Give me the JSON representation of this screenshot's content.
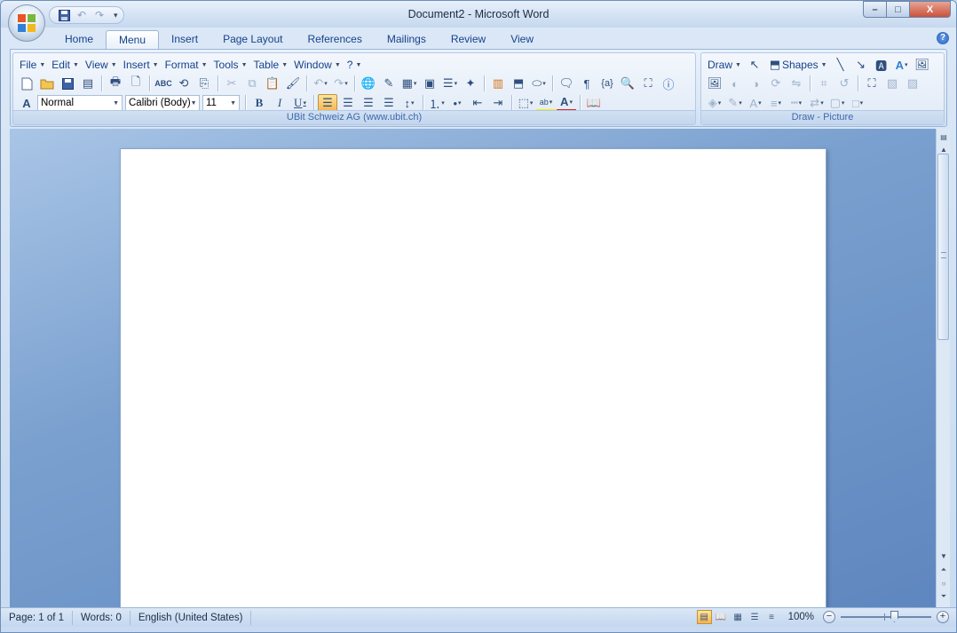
{
  "window": {
    "title": "Document2 - Microsoft Word",
    "controls": {
      "minimize": "–",
      "maximize": "□",
      "close": "X"
    }
  },
  "qat": {
    "items": [
      "save-icon",
      "undo-icon",
      "redo-icon",
      "customize-icon"
    ]
  },
  "tabs": [
    {
      "label": "Home",
      "active": false
    },
    {
      "label": "Menu",
      "active": true
    },
    {
      "label": "Insert",
      "active": false
    },
    {
      "label": "Page Layout",
      "active": false
    },
    {
      "label": "References",
      "active": false
    },
    {
      "label": "Mailings",
      "active": false
    },
    {
      "label": "Review",
      "active": false
    },
    {
      "label": "View",
      "active": false
    }
  ],
  "menu_bar": {
    "items": [
      "File",
      "Edit",
      "View",
      "Insert",
      "Format",
      "Tools",
      "Table",
      "Window",
      "?"
    ]
  },
  "format_bar": {
    "style": "Normal",
    "font": "Calibri (Body)",
    "size": "11",
    "bold": "B",
    "italic": "I",
    "underline": "U"
  },
  "groups": {
    "menu_label": "UBit Schweiz AG (www.ubit.ch)",
    "draw_label": "Draw - Picture",
    "draw_menu": "Draw",
    "shapes_menu": "Shapes"
  },
  "statusbar": {
    "page": "Page: 1 of 1",
    "words": "Words: 0",
    "language": "English (United States)",
    "zoom": "100%",
    "zoom_out": "−",
    "zoom_in": "+"
  },
  "colors": {
    "accent": "#15428b",
    "highlight": "#f8b44e",
    "font_color": "#e02020"
  }
}
